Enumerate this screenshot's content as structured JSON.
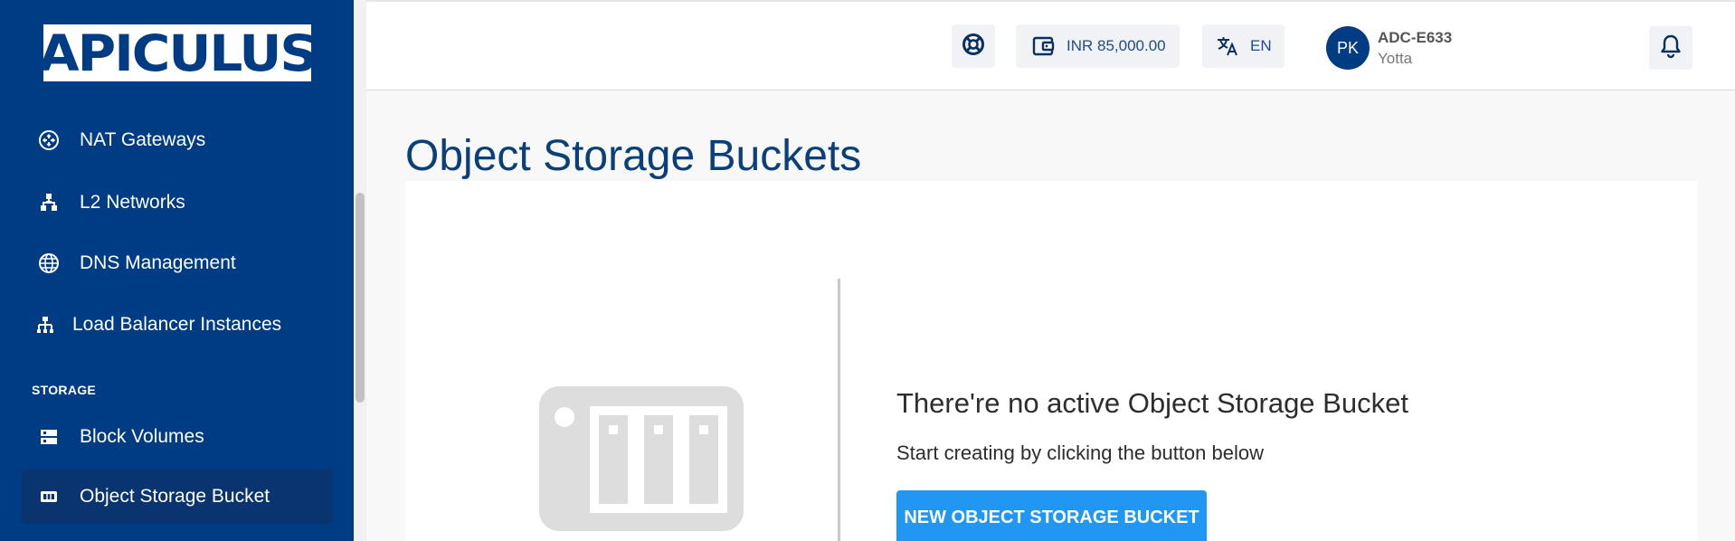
{
  "sidebar": {
    "logo": "APICULUS",
    "section_label": "STORAGE",
    "items": [
      {
        "label": "NAT Gateways",
        "icon": "nat-gateway-icon"
      },
      {
        "label": "L2 Networks",
        "icon": "network-hierarchy-icon"
      },
      {
        "label": "DNS Management",
        "icon": "globe-icon"
      },
      {
        "label": "Load Balancer Instances",
        "icon": "load-balancer-icon"
      },
      {
        "label": "Block Volumes",
        "icon": "block-volume-icon"
      },
      {
        "label": "Object Storage Bucket",
        "icon": "object-storage-icon",
        "active": true
      }
    ]
  },
  "header": {
    "support_icon": "lifebuoy-icon",
    "wallet": {
      "icon": "wallet-icon",
      "label": "INR 85,000.00"
    },
    "language": {
      "icon": "translate-icon",
      "label": "EN"
    },
    "user": {
      "initials": "PK",
      "name": "ADC-E633",
      "org": "Yotta"
    },
    "notifications_icon": "bell-icon"
  },
  "main": {
    "title": "Object Storage Buckets",
    "empty_state": {
      "icon": "storage-device-icon",
      "title": "There're no active Object Storage Bucket",
      "subtitle": "Start creating by clicking the button below",
      "button_label": "NEW OBJECT STORAGE BUCKET"
    }
  },
  "colors": {
    "sidebar_bg": "#003c83",
    "accent": "#2196f3",
    "title": "#0b3f7a"
  }
}
